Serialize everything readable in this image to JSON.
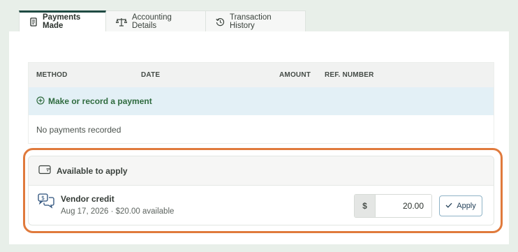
{
  "tabs": [
    {
      "label": "Payments Made",
      "icon": "receipt-icon",
      "active": true
    },
    {
      "label": "Accounting Details",
      "icon": "scale-icon",
      "active": false
    },
    {
      "label": "Transaction History",
      "icon": "history-icon",
      "active": false
    }
  ],
  "payments_table": {
    "columns": [
      "METHOD",
      "DATE",
      "AMOUNT",
      "REF. NUMBER"
    ],
    "add_action": {
      "label": "Make or record a payment",
      "icon": "plus-circle-icon"
    },
    "empty_text": "No payments recorded"
  },
  "available": {
    "title": "Available to apply",
    "icon": "wallet-icon",
    "credit": {
      "icon": "vendor-credit-icon",
      "title": "Vendor credit",
      "subtitle": "Aug 17, 2026 · $20.00 available",
      "currency_symbol": "$",
      "amount": "20.00",
      "apply_label": "Apply",
      "apply_icon": "check-icon"
    }
  },
  "colors": {
    "accent_tab": "#1f4a43",
    "add_action_text": "#2f6b3f",
    "add_action_bg": "#e3f0f6",
    "highlight_outline": "#e07a3c"
  }
}
